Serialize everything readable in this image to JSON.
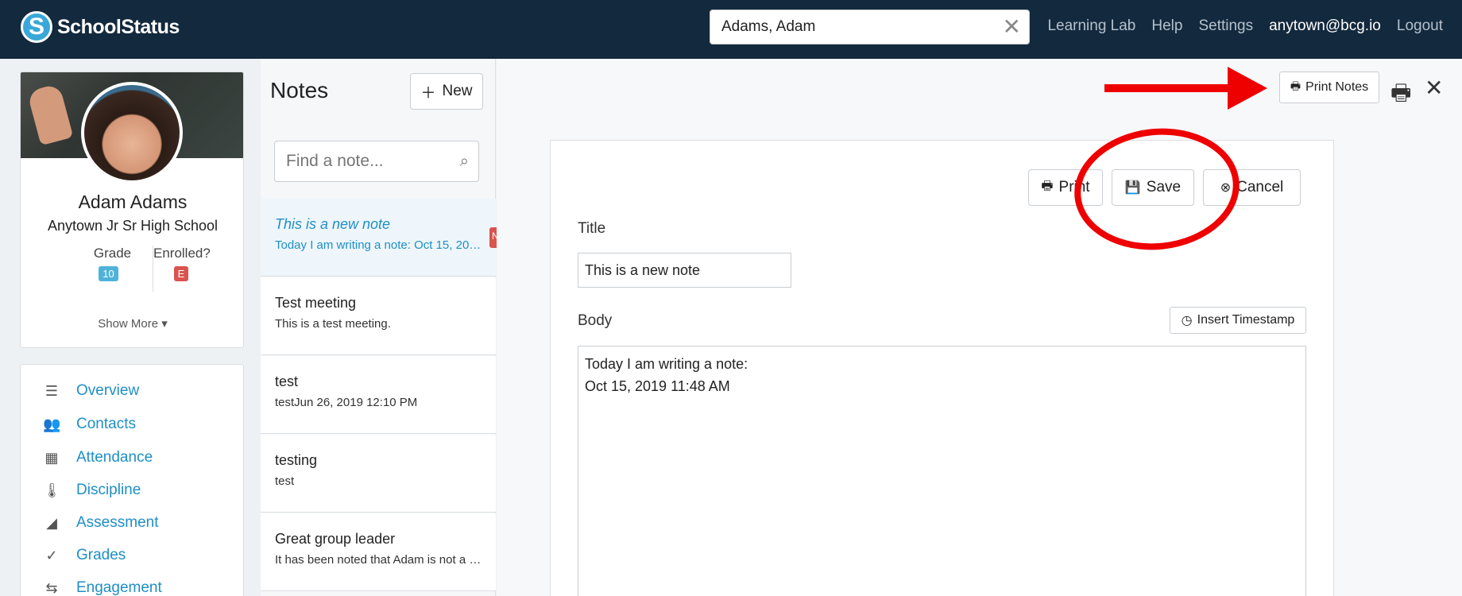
{
  "app": {
    "name": "SchoolStatus",
    "logo_letter": "S"
  },
  "header": {
    "search_value": "Adams, Adam",
    "links": [
      "Learning Lab",
      "Help",
      "Settings"
    ],
    "user_email": "anytown@bcg.io",
    "logout_label": "Logout"
  },
  "student": {
    "name": "Adam Adams",
    "school": "Anytown Jr Sr High School",
    "grade_label": "Grade",
    "grade_value": "10",
    "enrolled_label": "Enrolled?",
    "enrolled_value": "E",
    "show_more": "Show More ▾"
  },
  "nav": {
    "items": [
      {
        "label": "Overview",
        "icon": "list-icon"
      },
      {
        "label": "Contacts",
        "icon": "contacts-icon"
      },
      {
        "label": "Attendance",
        "icon": "calendar-icon"
      },
      {
        "label": "Discipline",
        "icon": "thermometer-icon"
      },
      {
        "label": "Assessment",
        "icon": "area-chart-icon"
      },
      {
        "label": "Grades",
        "icon": "check-icon"
      },
      {
        "label": "Engagement",
        "icon": "exchange-icon"
      }
    ]
  },
  "notes": {
    "title": "Notes",
    "new_label": "New",
    "search_placeholder": "Find a note...",
    "items": [
      {
        "title": "This is a new note",
        "body": "Today I am writing a note: Oct 15, 2019 11:48 AM",
        "flag": "N"
      },
      {
        "title": "Test meeting",
        "body": "This is a test meeting."
      },
      {
        "title": "test",
        "body": "testJun 26, 2019 12:10 PM"
      },
      {
        "title": "testing",
        "body": "test"
      },
      {
        "title": "Great group leader",
        "body": "It has been noted that Adam is not a great leader"
      }
    ]
  },
  "toolbar": {
    "print_notes_label": "Print Notes"
  },
  "editor": {
    "print_label": "Print",
    "save_label": "Save",
    "cancel_label": "Cancel",
    "title_label": "Title",
    "title_value": "This is a new note",
    "body_label": "Body",
    "timestamp_label": "Insert Timestamp",
    "body_line1": "Today I am writing a note:",
    "body_line2": "Oct 15, 2019 11:48 AM"
  },
  "colors": {
    "header_bg": "#13293d",
    "link_blue": "#1e8fc6",
    "annotation_red": "#ee0000",
    "badge_blue": "#4fb3d9",
    "badge_red": "#d9534f"
  }
}
